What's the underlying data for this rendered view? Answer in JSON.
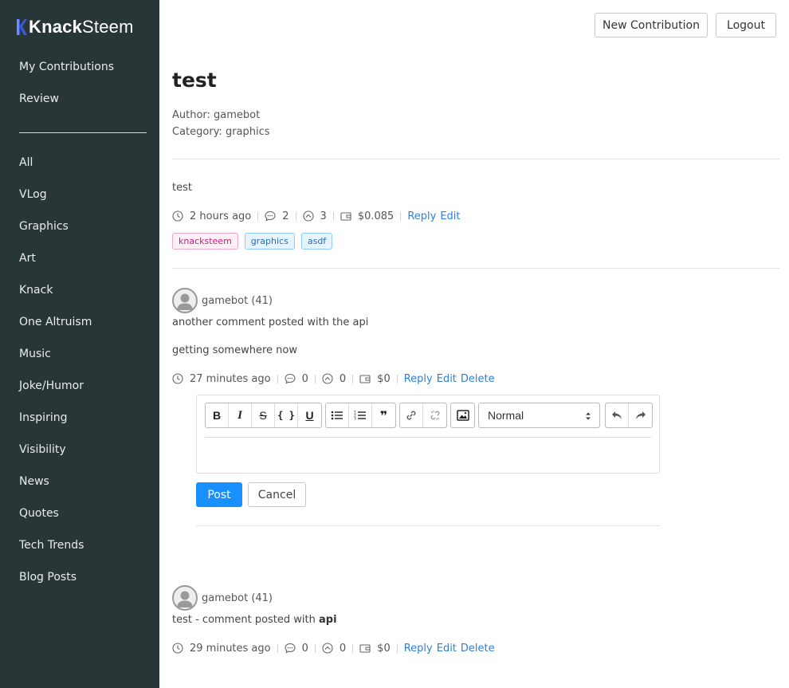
{
  "app": {
    "logo_bold": "Knack",
    "logo_light": "Steem"
  },
  "sidebar": {
    "top_items": [
      {
        "label": "My Contributions"
      },
      {
        "label": "Review"
      }
    ],
    "categories": [
      {
        "label": "All"
      },
      {
        "label": "VLog"
      },
      {
        "label": "Graphics"
      },
      {
        "label": "Art"
      },
      {
        "label": "Knack"
      },
      {
        "label": "One Altruism"
      },
      {
        "label": "Music"
      },
      {
        "label": "Joke/Humor"
      },
      {
        "label": "Inspiring"
      },
      {
        "label": "Visibility"
      },
      {
        "label": "News"
      },
      {
        "label": "Quotes"
      },
      {
        "label": "Tech Trends"
      },
      {
        "label": "Blog Posts"
      }
    ]
  },
  "header": {
    "new_contribution_label": "New Contribution",
    "logout_label": "Logout"
  },
  "post": {
    "title": "test",
    "author": "Author: gamebot",
    "category": "Category: graphics",
    "body": "test",
    "time": "2 hours ago",
    "comments": "2",
    "votes": "3",
    "payout": "$0.085",
    "reply_label": "Reply",
    "edit_label": "Edit",
    "tags": [
      "knacksteem",
      "graphics",
      "asdf"
    ]
  },
  "comments": [
    {
      "user": "gamebot (41)",
      "line1": "another comment posted with the api",
      "line2": "getting somewhere now",
      "time": "27 minutes ago",
      "comments": "0",
      "votes": "0",
      "payout": "$0",
      "reply_label": "Reply",
      "edit_label": "Edit",
      "delete_label": "Delete"
    },
    {
      "user": "gamebot (41)",
      "text_prefix": "test - comment posted with ",
      "text_bold": "api",
      "time": "29 minutes ago",
      "comments": "0",
      "votes": "0",
      "payout": "$0",
      "reply_label": "Reply",
      "edit_label": "Edit",
      "delete_label": "Delete"
    }
  ],
  "editor": {
    "format_value": "Normal",
    "post_label": "Post",
    "cancel_label": "Cancel",
    "bold_glyph": "B",
    "italic_glyph": "I",
    "strike_glyph": "S",
    "code_glyph": "{ }",
    "underline_glyph": "U",
    "quote_glyph": "❞"
  },
  "colors": {
    "sidebar_bg": "#283637",
    "link": "#2f7fd8",
    "primary_button": "#1890ff",
    "tag_pink": "#c41d7f",
    "tag_blue": "#2a6db8"
  }
}
